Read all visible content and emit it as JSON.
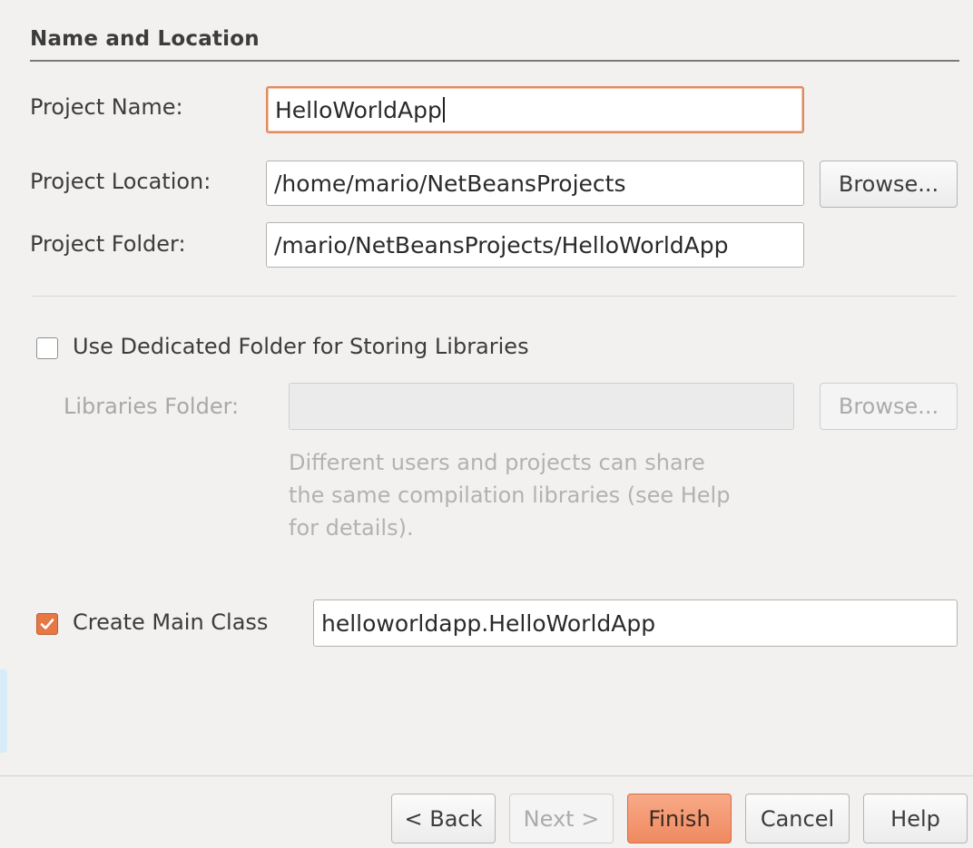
{
  "section": {
    "title": "Name and Location"
  },
  "project_name": {
    "label": "Project Name:",
    "value": "HelloWorldApp"
  },
  "project_location": {
    "label": "Project Location:",
    "value": "/home/mario/NetBeansProjects",
    "browse_label": "Browse..."
  },
  "project_folder": {
    "label": "Project Folder:",
    "value": "/mario/NetBeansProjects/HelloWorldApp"
  },
  "libraries": {
    "checkbox_label": "Use Dedicated Folder for Storing Libraries",
    "checked": false,
    "folder_label": "Libraries Folder:",
    "folder_value": "",
    "browse_label": "Browse...",
    "hint_lines": [
      "Different users and projects can share",
      "the same compilation libraries (see Help",
      "for details)."
    ]
  },
  "main_class": {
    "checkbox_label": "Create Main Class",
    "checked": true,
    "value": "helloworldapp.HelloWorldApp"
  },
  "footer": {
    "back_label": "< Back",
    "next_label": "Next >",
    "finish_label": "Finish",
    "cancel_label": "Cancel",
    "help_label": "Help"
  },
  "colors": {
    "accent": "#ef8a60",
    "focus_border": "#e08a62"
  }
}
